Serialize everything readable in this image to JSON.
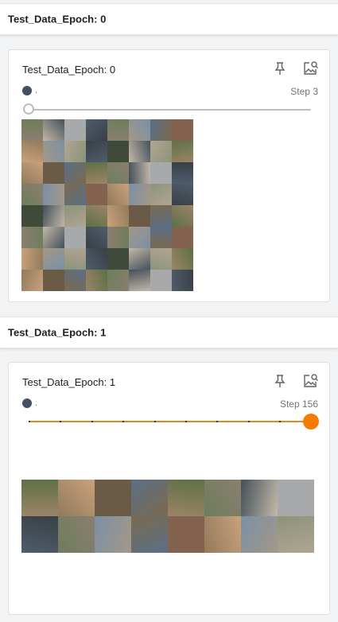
{
  "sections": [
    {
      "header": "Test_Data_Epoch: 0",
      "card": {
        "title": "Test_Data_Epoch: 0",
        "run_name": ".",
        "step": "Step 3",
        "slider_fraction": 0.0,
        "run_color": "#425066",
        "grid": {
          "cols": 8,
          "rows": 8
        }
      }
    },
    {
      "header": "Test_Data_Epoch: 1",
      "card": {
        "title": "Test_Data_Epoch: 1",
        "run_name": ".",
        "step": "Step 156",
        "slider_fraction": 1.0,
        "run_color": "#425066",
        "accent_color": "#f57c00",
        "grid": {
          "cols": 8,
          "rows": 2
        }
      }
    }
  ],
  "icons": {
    "pin": "pin-icon",
    "image_search": "image-search-icon"
  }
}
